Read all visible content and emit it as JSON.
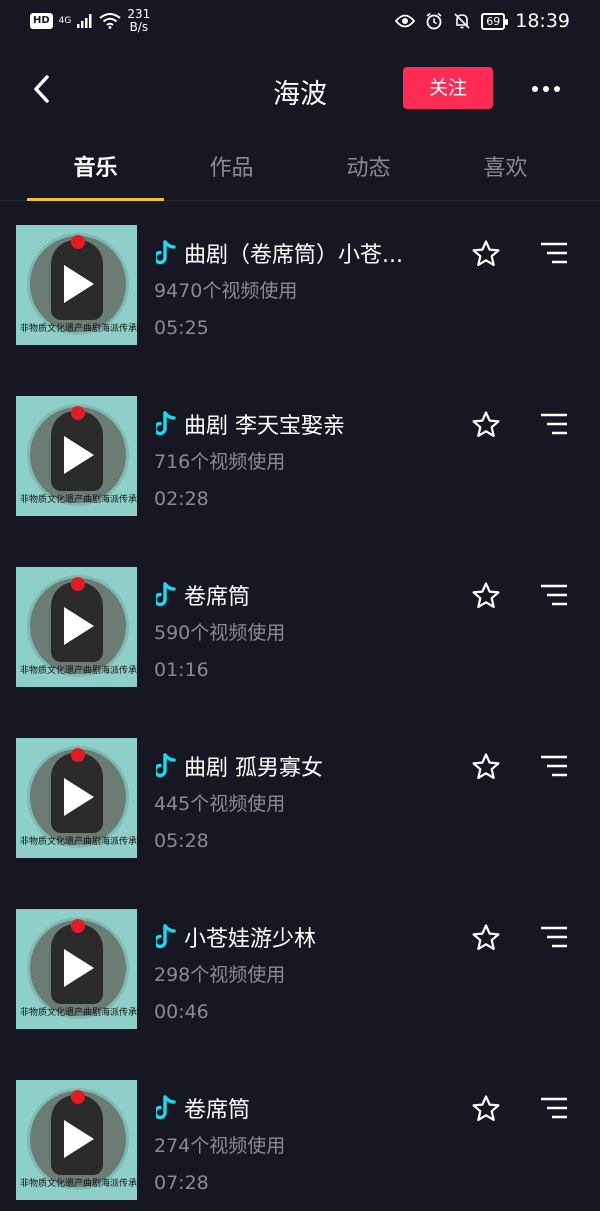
{
  "status": {
    "hd": "HD",
    "network": "4G",
    "speed_value": "231",
    "speed_unit": "B/s",
    "battery": "69",
    "time": "18:39"
  },
  "header": {
    "title": "海波",
    "follow_label": "关注"
  },
  "tabs": [
    {
      "label": "音乐"
    },
    {
      "label": "作品"
    },
    {
      "label": "动态"
    },
    {
      "label": "喜欢"
    }
  ],
  "thumb_ring_text": "非物质文化遗产曲剧海派传承人",
  "tracks": [
    {
      "title": "曲剧（卷席筒）小苍...",
      "uses": "9470个视频使用",
      "duration": "05:25"
    },
    {
      "title": "曲剧   李天宝娶亲",
      "uses": "716个视频使用",
      "duration": "02:28"
    },
    {
      "title": "卷席筒",
      "uses": "590个视频使用",
      "duration": "01:16"
    },
    {
      "title": "曲剧   孤男寡女",
      "uses": "445个视频使用",
      "duration": "05:28"
    },
    {
      "title": "小苍娃游少林",
      "uses": "298个视频使用",
      "duration": "00:46"
    },
    {
      "title": "卷席筒",
      "uses": "274个视频使用",
      "duration": "07:28"
    }
  ],
  "colors": {
    "background": "#161722",
    "accent": "#fe2c55",
    "tab_indicator": "#f4c12a",
    "music_note": "#20d5ec"
  }
}
